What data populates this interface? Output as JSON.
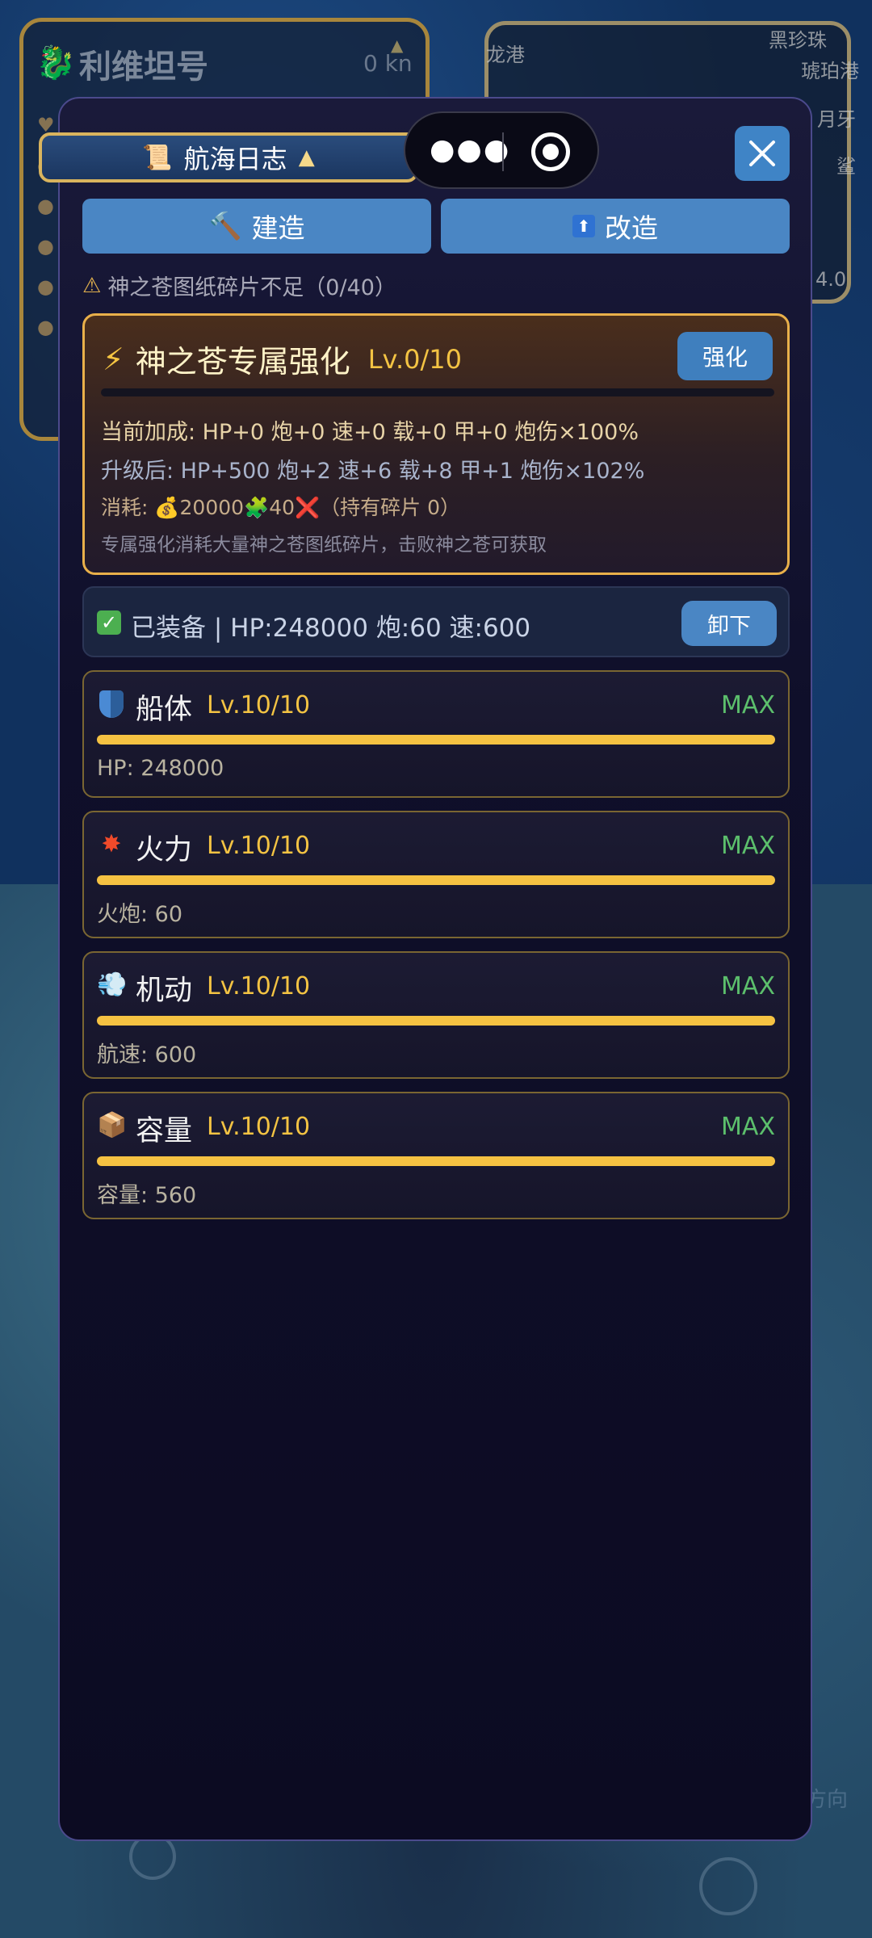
{
  "background": {
    "ship_name": "利维坦号",
    "speed": "0 kn",
    "map_labels": [
      "黑珍珠",
      "琥珀港",
      "月牙",
      "鲨",
      "龙港",
      "4.0"
    ],
    "hint": "方向"
  },
  "top": {
    "log_tab_label": "航海日志",
    "close_label": "×"
  },
  "tabs": {
    "build_label": "建造",
    "refit_label": "改造"
  },
  "warning": "神之苍图纸碎片不足（0/40）",
  "enhancement": {
    "title": "神之苍专属强化",
    "level": "Lv.0/10",
    "progress": 0.0,
    "button": "强化",
    "current_bonus": "当前加成: HP+0 炮+0 速+0 载+0 甲+0 炮伤×100%",
    "next_bonus": "升级后: HP+500 炮+2 速+6 载+8 甲+1 炮伤×102%",
    "cost_prefix": "消耗: ",
    "cost_gold": "20000",
    "cost_fragments": "40",
    "cost_held": "（持有碎片 0）",
    "note": "专属强化消耗大量神之苍图纸碎片，击败神之苍可获取"
  },
  "equipped": {
    "text": "已装备 | HP:248000 炮:60 速:600",
    "button": "卸下"
  },
  "stats": [
    {
      "icon": "shield-icon",
      "name": "船体",
      "level": "Lv.10/10",
      "max": "MAX",
      "value": "HP: 248000",
      "progress": 1.0
    },
    {
      "icon": "explosion-icon",
      "name": "火力",
      "level": "Lv.10/10",
      "max": "MAX",
      "value": "火炮: 60",
      "progress": 1.0
    },
    {
      "icon": "wind-icon",
      "name": "机动",
      "level": "Lv.10/10",
      "max": "MAX",
      "value": "航速: 600",
      "progress": 1.0
    },
    {
      "icon": "box-icon",
      "name": "容量",
      "level": "Lv.10/10",
      "max": "MAX",
      "value": "容量: 560",
      "progress": 1.0
    }
  ],
  "colors": {
    "accent_blue": "#4a86c4",
    "gold": "#f3c343",
    "max_green": "#5cbf6c"
  }
}
